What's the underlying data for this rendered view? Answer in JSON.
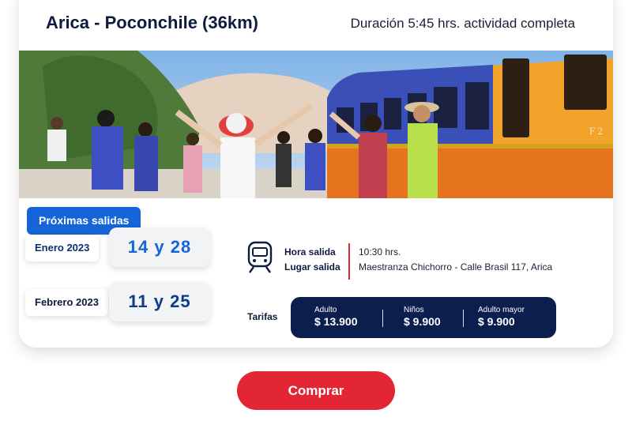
{
  "header": {
    "title": "Arica - Poconchile (36km)",
    "duration": "Duración 5:45 hrs. actividad completa"
  },
  "photo": {
    "train_label": "F 2"
  },
  "departures": {
    "badge": "Próximas salidas",
    "months": [
      {
        "month": "Enero 2023",
        "days": "14 y 28"
      },
      {
        "month": "Febrero 2023",
        "days": "11 y 25"
      }
    ]
  },
  "details": {
    "icon": "train-icon",
    "labels": [
      "Hora salida",
      "Lugar salida"
    ],
    "values": [
      "10:30 hrs.",
      "Maestranza Chichorro  - Calle Brasil 117, Arica"
    ]
  },
  "fares": {
    "label": "Tarifas",
    "items": [
      {
        "name": "Adulto",
        "price": "$ 13.900"
      },
      {
        "name": "Niños",
        "price": "$ 9.900"
      },
      {
        "name": "Adulto mayor",
        "price": "$ 9.900"
      }
    ]
  },
  "cta": {
    "label": "Comprar"
  },
  "colors": {
    "primary_blue": "#1565d8",
    "navy": "#0b1e4d",
    "accent_red": "#e32636"
  }
}
